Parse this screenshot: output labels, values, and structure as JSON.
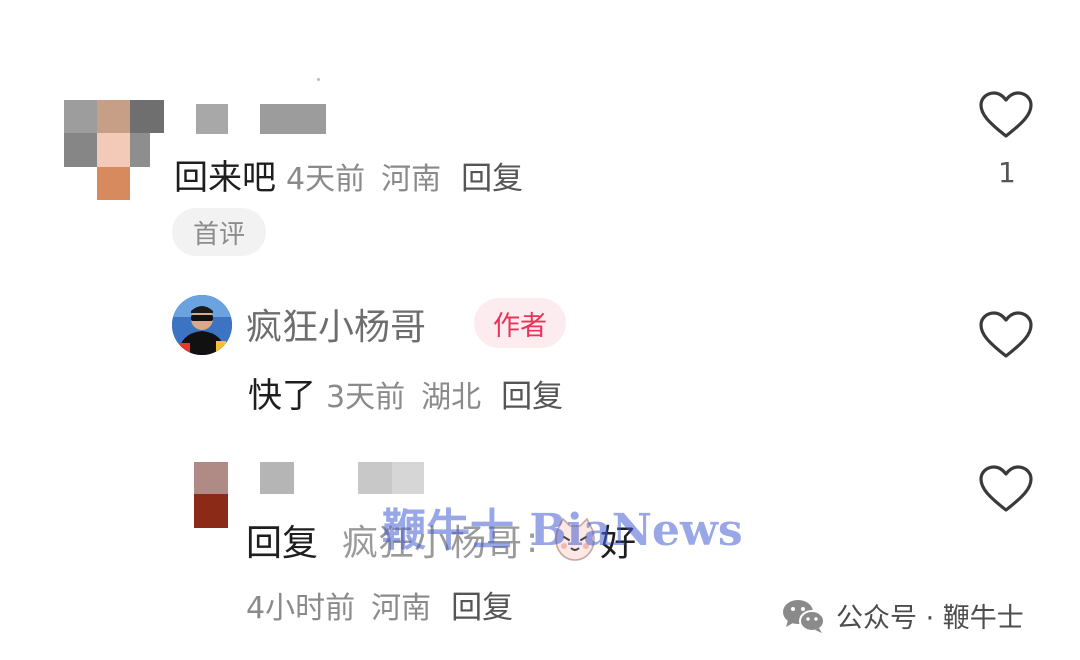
{
  "comment": {
    "text": "回来吧",
    "time": "4天前",
    "location": "河南",
    "reply_label": "回复",
    "badge": "首评",
    "likes": "1"
  },
  "author_reply": {
    "username": "疯狂小杨哥",
    "badge": "作者",
    "text": "快了",
    "time": "3天前",
    "location": "湖北",
    "reply_label": "回复"
  },
  "sub_reply": {
    "prefix": "回复",
    "target": "疯狂小杨哥",
    "colon": ":",
    "text": "好",
    "time": "4小时前",
    "location": "河南",
    "reply_label": "回复"
  },
  "watermark": "鞭牛士 BiaNews",
  "footer": {
    "text": "公众号 · 鞭牛士"
  },
  "icons": {
    "like": "heart-outline-icon",
    "wechat": "wechat-logo-icon",
    "emoji": "cat-face-emoji"
  },
  "colors": {
    "author_badge_bg": "#fdecef",
    "author_badge_text": "#e8345a",
    "watermark": "#465fd2"
  }
}
